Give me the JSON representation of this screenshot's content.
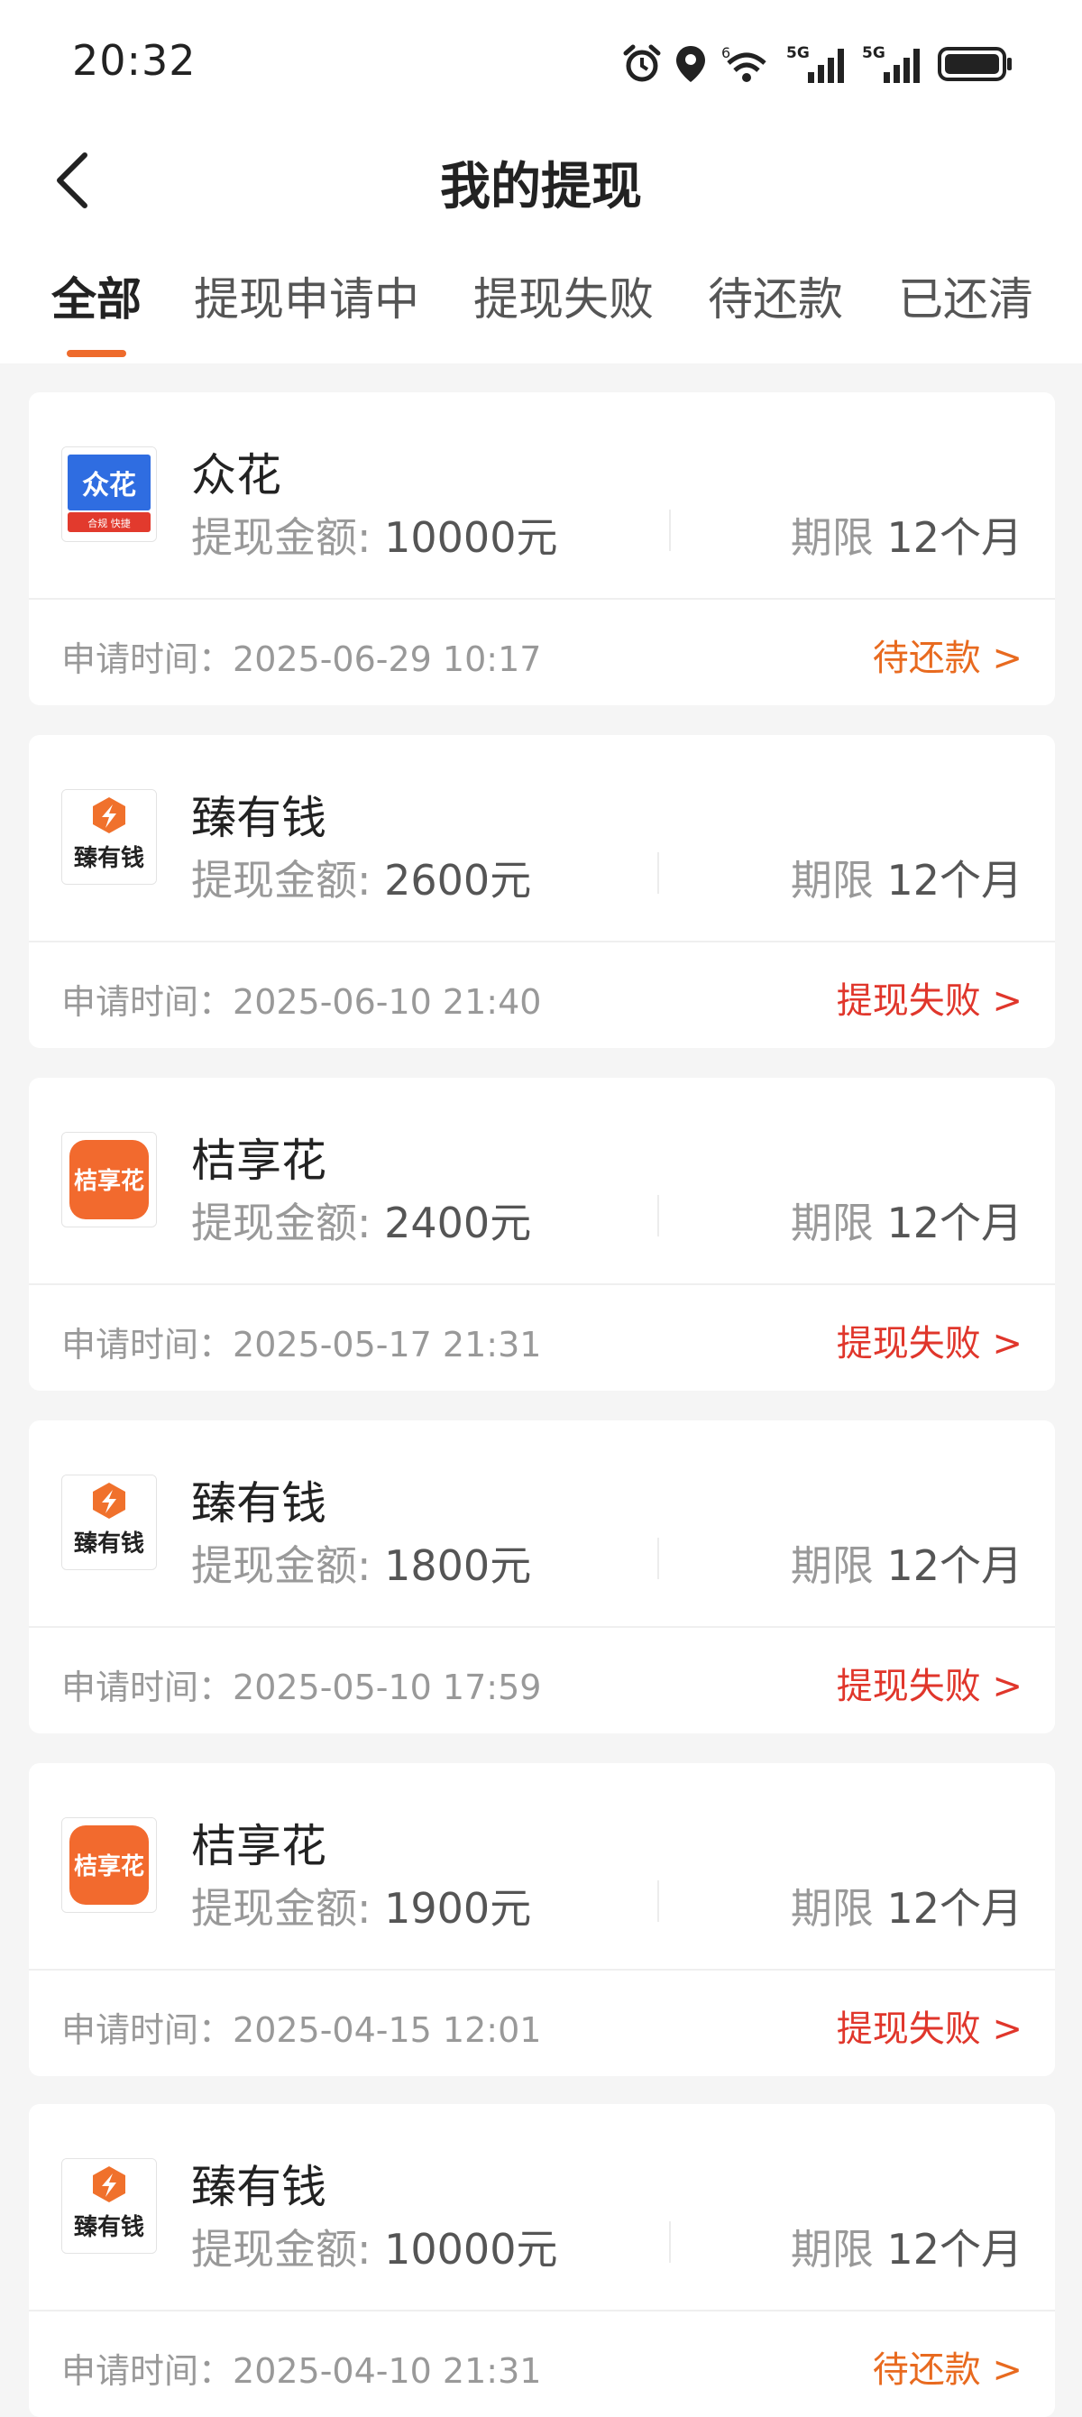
{
  "status_bar": {
    "time": "20:32",
    "network_label_1": "5G",
    "network_label_2": "5G",
    "wifi_badge": "6"
  },
  "header": {
    "title": "我的提现"
  },
  "tabs": [
    {
      "label": "全部"
    },
    {
      "label": "提现申请中"
    },
    {
      "label": "提现失败"
    },
    {
      "label": "待还款"
    },
    {
      "label": "已还清"
    }
  ],
  "labels": {
    "amount_prefix": "提现金额: ",
    "term_prefix": "期限 ",
    "apply_prefix": "申请时间："
  },
  "colors": {
    "accent": "#ee6b2c",
    "pending": "#e86a1f",
    "failed": "#e0362b"
  },
  "records": [
    {
      "name": "众花",
      "logo": "zhonghua-logo",
      "logo_text": "众花",
      "logo_subtext": "合规 快捷",
      "amount": "10000元",
      "term": "12个月",
      "apply_time": "2025-06-29 10:17",
      "status": "待还款 >",
      "status_type": "pending"
    },
    {
      "name": "臻有钱",
      "logo": "zhenyouqian-logo",
      "logo_text": "臻有钱",
      "amount": "2600元",
      "term": "12个月",
      "apply_time": "2025-06-10 21:40",
      "status": "提现失败 >",
      "status_type": "failed"
    },
    {
      "name": "桔享花",
      "logo": "jiexianghua-logo",
      "logo_text": "桔享花",
      "amount": "2400元",
      "term": "12个月",
      "apply_time": "2025-05-17 21:31",
      "status": "提现失败 >",
      "status_type": "failed"
    },
    {
      "name": "臻有钱",
      "logo": "zhenyouqian-logo",
      "logo_text": "臻有钱",
      "amount": "1800元",
      "term": "12个月",
      "apply_time": "2025-05-10 17:59",
      "status": "提现失败 >",
      "status_type": "failed"
    },
    {
      "name": "桔享花",
      "logo": "jiexianghua-logo",
      "logo_text": "桔享花",
      "amount": "1900元",
      "term": "12个月",
      "apply_time": "2025-04-15 12:01",
      "status": "提现失败 >",
      "status_type": "failed"
    },
    {
      "name": "臻有钱",
      "logo": "zhenyouqian-logo",
      "logo_text": "臻有钱",
      "amount": "10000元",
      "term": "12个月",
      "apply_time": "2025-04-10 21:31",
      "status": "待还款 >",
      "status_type": "pending"
    }
  ]
}
